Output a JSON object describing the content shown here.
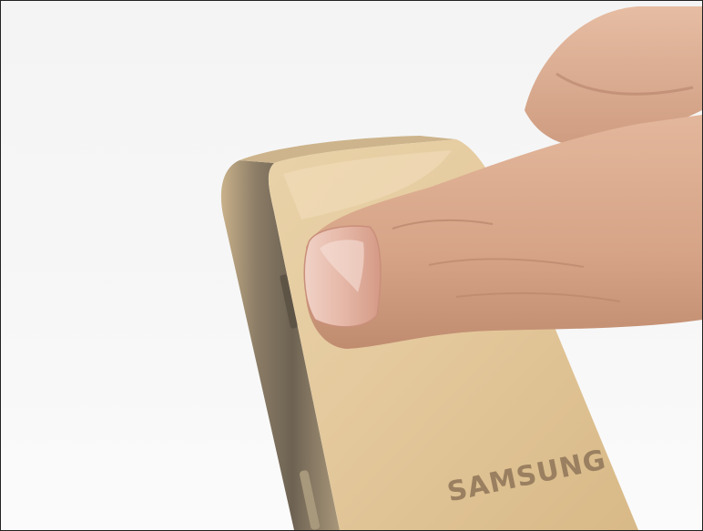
{
  "photo": {
    "description_visible_text": "SAMSUNG",
    "brand_logo": "SAMSUNG"
  },
  "colors": {
    "background": "#f5f5f5",
    "phone_gold": "#e2c79b",
    "phone_edge": "#8c7d68",
    "skin": "#d9a98c",
    "skin_shadow": "#b07f66",
    "frame_border": "#222222"
  }
}
